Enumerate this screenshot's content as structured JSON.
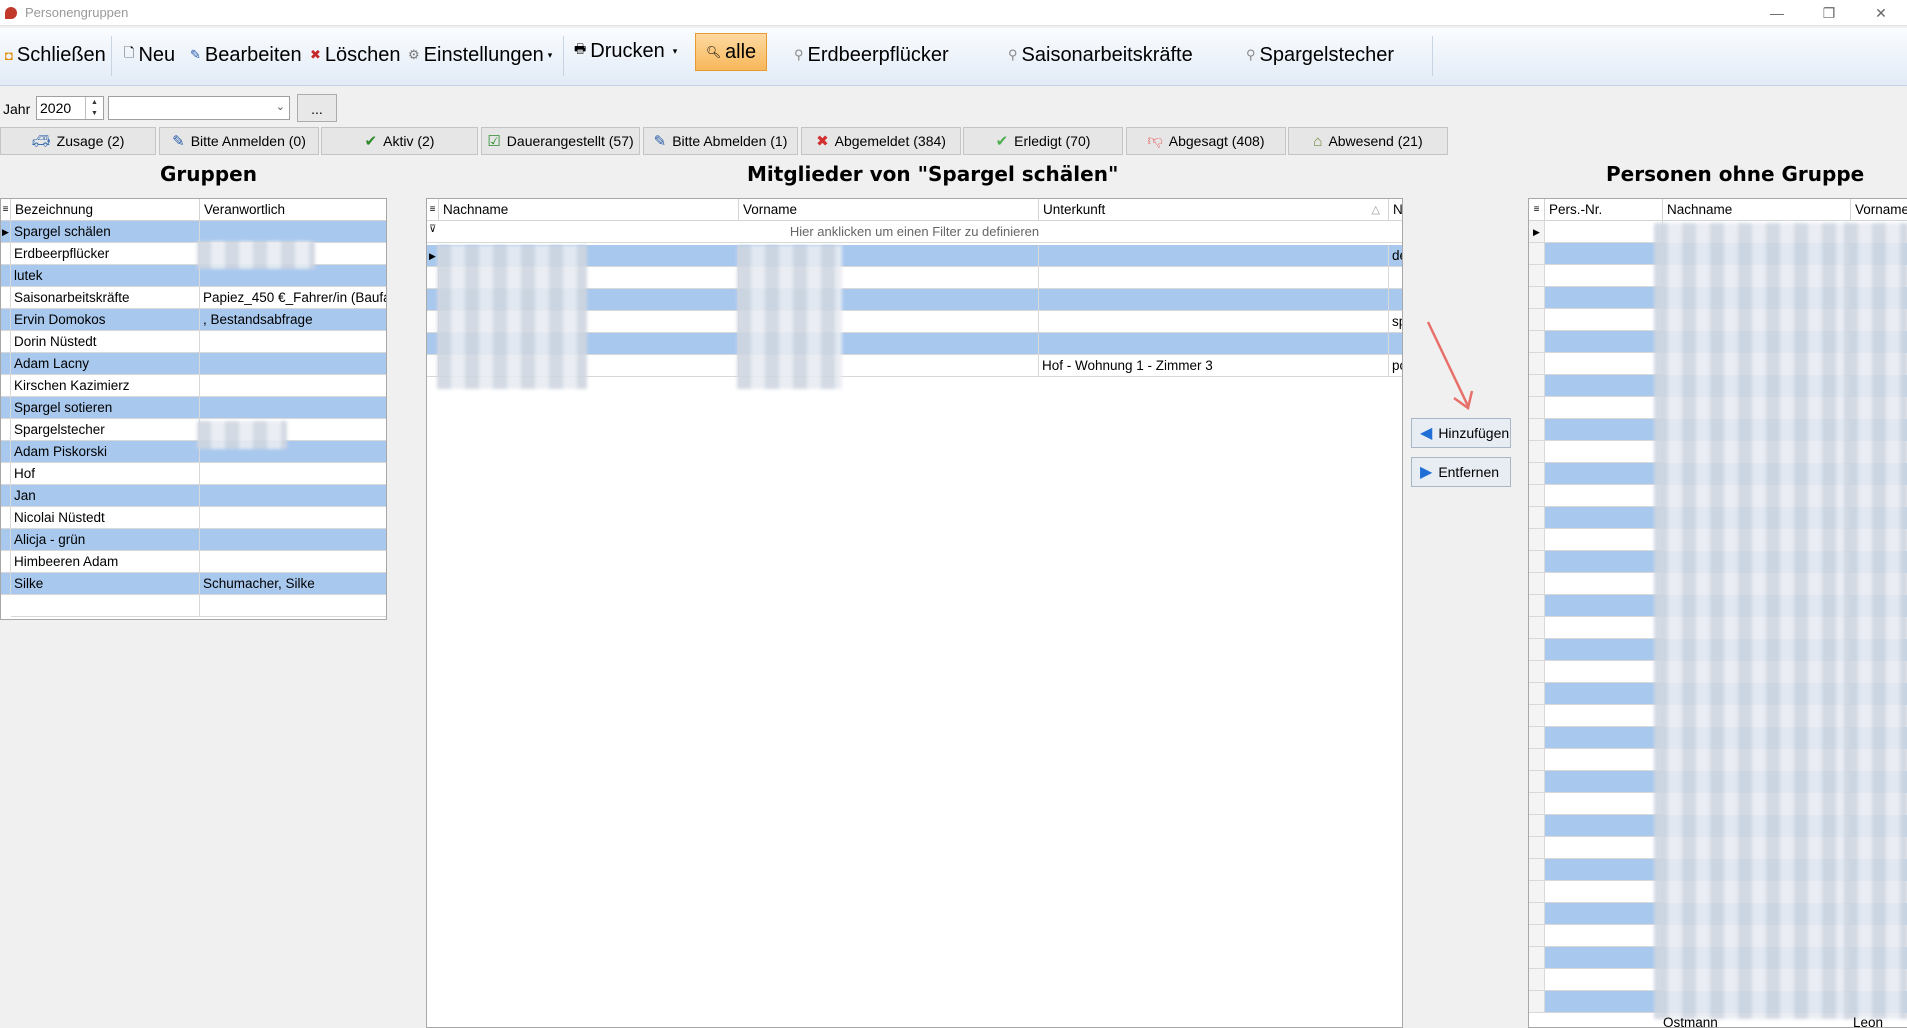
{
  "window": {
    "title": "Personengruppen",
    "minimize": "—",
    "restore": "❐",
    "close": "✕"
  },
  "toolbar": {
    "close_label": "Schließen",
    "new_label": "Neu",
    "edit_label": "Bearbeiten",
    "delete_label": "Löschen",
    "settings_label": "Einstellungen",
    "print_label": "Drucken",
    "all_label": "alle",
    "filter1_label": "Erdbeerpflücker",
    "filter2_label": "Saisonarbeitskräfte",
    "filter3_label": "Spargelstecher"
  },
  "filters": {
    "year_label": "Jahr",
    "year_value": "2020",
    "combo_value": "",
    "dots_label": "..."
  },
  "status_buttons": [
    {
      "label": "Zusage (2)",
      "icon": "car-icon"
    },
    {
      "label": "Bitte Anmelden (0)",
      "icon": "edit-icon"
    },
    {
      "label": "Aktiv (2)",
      "icon": "check-icon"
    },
    {
      "label": "Dauerangestellt (57)",
      "icon": "checkbox-icon"
    },
    {
      "label": "Bitte Abmelden (1)",
      "icon": "edit-icon"
    },
    {
      "label": "Abgemeldet (384)",
      "icon": "x-icon"
    },
    {
      "label": "Erledigt (70)",
      "icon": "check-icon"
    },
    {
      "label": "Abgesagt (408)",
      "icon": "thumbs-down-icon"
    },
    {
      "label": "Abwesend (21)",
      "icon": "house-icon"
    }
  ],
  "groups": {
    "heading": "Gruppen",
    "columns": [
      "Bezeichnung",
      "Veranwortlich"
    ],
    "rows": [
      [
        "Spargel schälen",
        ""
      ],
      [
        "Erdbeerpflücker",
        ""
      ],
      [
        "lutek",
        ""
      ],
      [
        "Saisonarbeitskräfte",
        "Papiez_450 €_Fahrer/in (Baufa"
      ],
      [
        "Ervin Domokos",
        ", Bestandsabfrage"
      ],
      [
        "Dorin Nüstedt",
        ""
      ],
      [
        "Adam Lacny",
        ""
      ],
      [
        "Kirschen Kazimierz",
        ""
      ],
      [
        "Spargel sotieren",
        ""
      ],
      [
        "Spargelstecher",
        ""
      ],
      [
        "Adam Piskorski",
        ""
      ],
      [
        "Hof",
        ""
      ],
      [
        "Jan",
        ""
      ],
      [
        "Nicolai Nüstedt",
        ""
      ],
      [
        "Alicja - grün",
        ""
      ],
      [
        "Himbeeren Adam",
        ""
      ],
      [
        "Silke",
        "Schumacher, Silke"
      ]
    ]
  },
  "members": {
    "heading": "Mitglieder von \"Spargel schälen\"",
    "columns": [
      "Nachname",
      "Vorname",
      "Unterkunft",
      "Na"
    ],
    "filter_hint": "Hier anklicken um einen Filter zu definieren",
    "rows": [
      [
        "",
        "",
        "",
        "de"
      ],
      [
        "",
        "",
        "",
        ""
      ],
      [
        "",
        "",
        "",
        ""
      ],
      [
        "",
        "",
        "",
        "sp"
      ],
      [
        "",
        "",
        "",
        ""
      ],
      [
        "",
        "",
        "Hof - Wohnung 1 - Zimmer 3",
        "po"
      ]
    ]
  },
  "actions": {
    "add_label": "Hinzufügen",
    "remove_label": "Entfernen"
  },
  "ungrouped": {
    "heading": "Personen ohne Gruppe",
    "columns": [
      "Pers.-Nr.",
      "Nachname",
      "Vorname"
    ],
    "last_nachname": "Ostmann",
    "last_vorname": "Leon"
  }
}
